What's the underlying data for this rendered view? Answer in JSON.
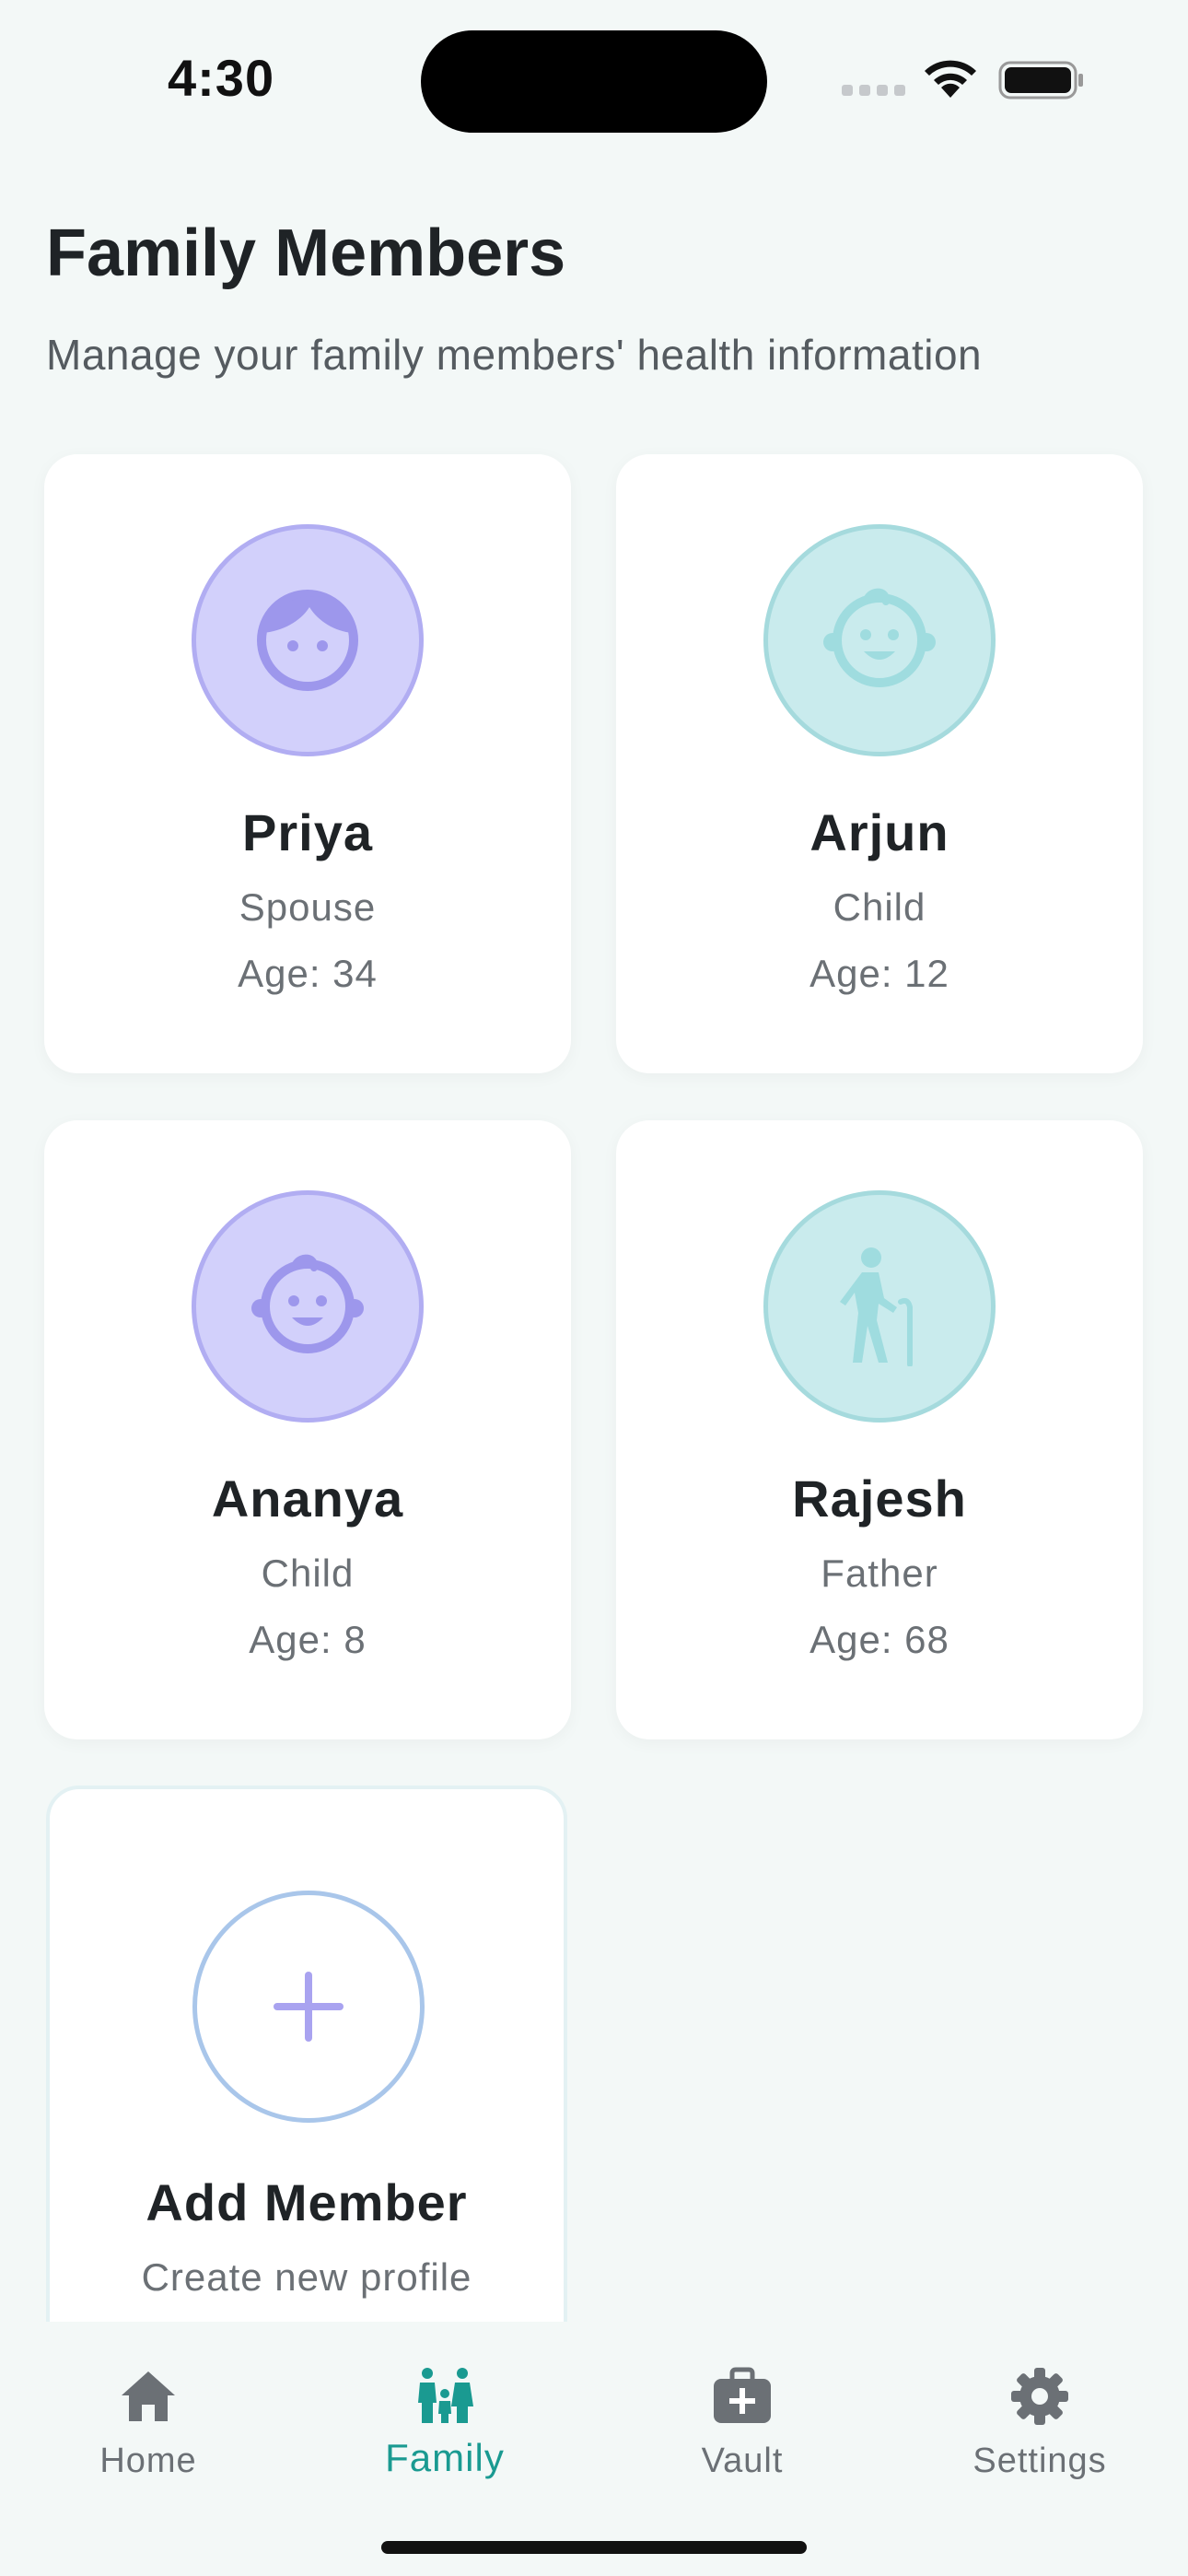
{
  "status_bar": {
    "time": "4:30"
  },
  "header": {
    "title": "Family Members",
    "subtitle": "Manage your family members' health information"
  },
  "members": [
    {
      "name": "Priya",
      "relation": "Spouse",
      "age": "Age: 34",
      "icon": "woman-face-icon",
      "color": "#d2d0fb"
    },
    {
      "name": "Arjun",
      "relation": "Child",
      "age": "Age: 12",
      "icon": "child-face-icon",
      "color": "#c9ebed"
    },
    {
      "name": "Ananya",
      "relation": "Child",
      "age": "Age: 8",
      "icon": "child-face-icon",
      "color": "#d2d0fb"
    },
    {
      "name": "Rajesh",
      "relation": "Father",
      "age": "Age: 68",
      "icon": "elderly-person-icon",
      "color": "#c9ebed"
    }
  ],
  "add_member": {
    "title": "Add Member",
    "subtitle": "Create new profile",
    "icon": "plus-icon"
  },
  "tabs": [
    {
      "label": "Home",
      "icon": "home-icon",
      "active": false
    },
    {
      "label": "Family",
      "icon": "family-icon",
      "active": true
    },
    {
      "label": "Vault",
      "icon": "medical-bag-icon",
      "active": false
    },
    {
      "label": "Settings",
      "icon": "gear-icon",
      "active": false
    }
  ],
  "colors": {
    "accent": "#1a9a91",
    "purple": "#a9a3f0",
    "teal": "#9fdcdf",
    "background": "#f3f8f7"
  }
}
